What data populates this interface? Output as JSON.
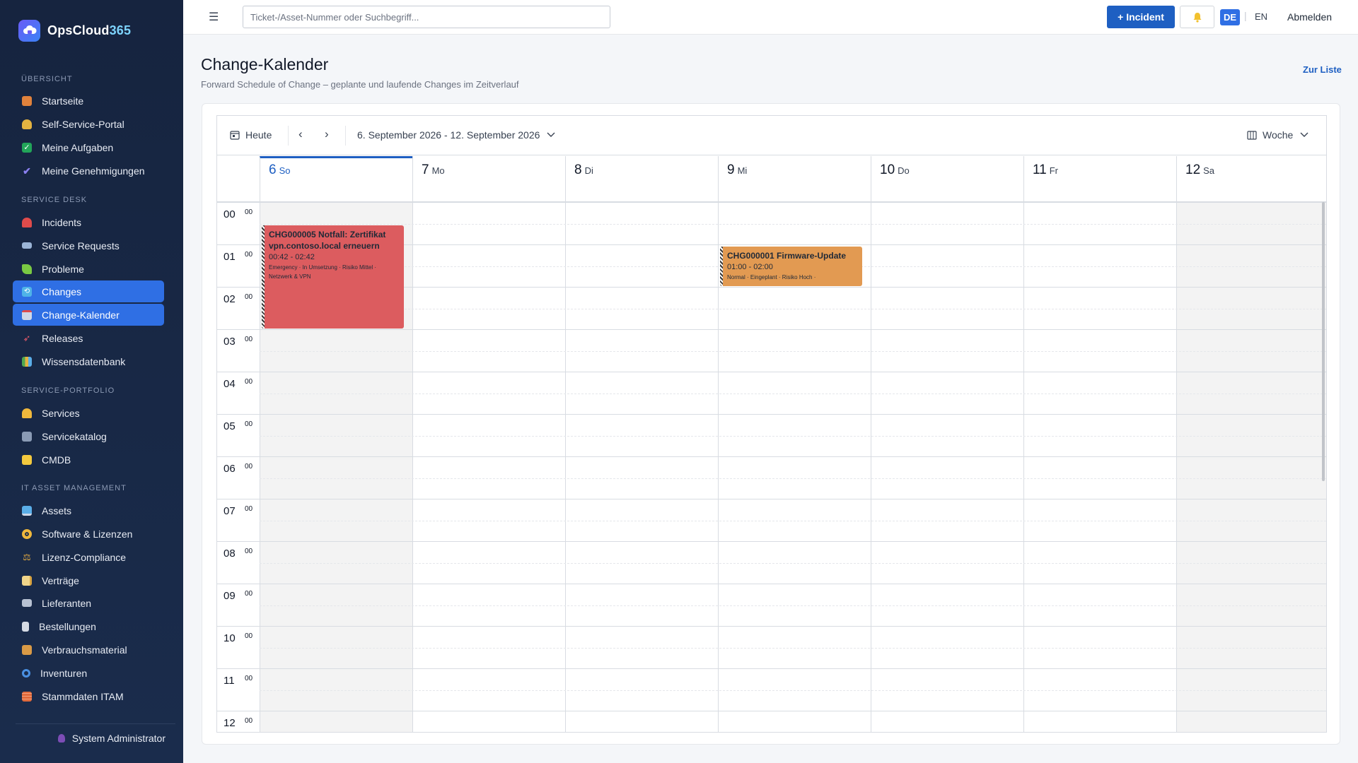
{
  "brand": {
    "name": "OpsCloud",
    "suffix": "365"
  },
  "sidebar": {
    "sections": [
      {
        "label": "Übersicht"
      },
      {
        "label": "Service Desk"
      },
      {
        "label": "Service-Portfolio"
      },
      {
        "label": "IT Asset Management"
      }
    ],
    "items": [
      {
        "label": "Startseite",
        "icon": "house-icon",
        "color": "#e0823c"
      },
      {
        "label": "Self-Service-Portal",
        "icon": "person-icon",
        "color": "#e3b341"
      },
      {
        "label": "Meine Aufgaben",
        "icon": "checkbox-icon",
        "color": "#22a559"
      },
      {
        "label": "Meine Genehmigungen",
        "icon": "check-icon",
        "color": "#8b80f0"
      },
      {
        "label": "Incidents",
        "icon": "siren-icon",
        "color": "#e04b4b"
      },
      {
        "label": "Service Requests",
        "icon": "tray-icon",
        "color": "#9bb4d6"
      },
      {
        "label": "Probleme",
        "icon": "puzzle-icon",
        "color": "#7ac943"
      },
      {
        "label": "Changes",
        "icon": "refresh-icon",
        "color": "#4fb3e8"
      },
      {
        "label": "Change-Kalender",
        "icon": "calendar-icon",
        "color": "#cfd8e8"
      },
      {
        "label": "Releases",
        "icon": "rocket-icon",
        "color": "#e85a6b"
      },
      {
        "label": "Wissensdatenbank",
        "icon": "books-icon",
        "color": "#4fa84f"
      },
      {
        "label": "Services",
        "icon": "bell-icon",
        "color": "#f0b83c"
      },
      {
        "label": "Servicekatalog",
        "icon": "catalog-icon",
        "color": "#8a9bb5"
      },
      {
        "label": "CMDB",
        "icon": "folder-icon",
        "color": "#f3c93e"
      },
      {
        "label": "Assets",
        "icon": "monitor-icon",
        "color": "#5aaee8"
      },
      {
        "label": "Software & Lizenzen",
        "icon": "disc-icon",
        "color": "#f0b83c"
      },
      {
        "label": "Lizenz-Compliance",
        "icon": "scale-icon",
        "color": "#d9a441"
      },
      {
        "label": "Verträge",
        "icon": "document-icon",
        "color": "#f0d58a"
      },
      {
        "label": "Lieferanten",
        "icon": "truck-icon",
        "color": "#b8c2d3"
      },
      {
        "label": "Bestellungen",
        "icon": "receipt-icon",
        "color": "#d6dbe4"
      },
      {
        "label": "Verbrauchsmaterial",
        "icon": "box-icon",
        "color": "#d99a46"
      },
      {
        "label": "Inventuren",
        "icon": "magnifier-icon",
        "color": "#4a90e2"
      },
      {
        "label": "Stammdaten ITAM",
        "icon": "bricks-icon",
        "color": "#e06a3c"
      }
    ],
    "user": "System Administrator"
  },
  "topbar": {
    "search_placeholder": "Ticket-/Asset-Nummer oder Suchbegriff...",
    "incident_button": "+ Incident",
    "lang_de": "DE",
    "lang_en": "EN",
    "logout": "Abmelden"
  },
  "page": {
    "title": "Change-Kalender",
    "subtitle": "Forward Schedule of Change – geplante und laufende Changes im Zeitverlauf",
    "back_link": "Zur Liste"
  },
  "calendar": {
    "today_label": "Heute",
    "range": "6. September 2026 - 12. September 2026",
    "view": "Woche",
    "days": [
      {
        "num": "6",
        "name": "So"
      },
      {
        "num": "7",
        "name": "Mo"
      },
      {
        "num": "8",
        "name": "Di"
      },
      {
        "num": "9",
        "name": "Mi"
      },
      {
        "num": "10",
        "name": "Do"
      },
      {
        "num": "11",
        "name": "Fr"
      },
      {
        "num": "12",
        "name": "Sa"
      }
    ],
    "hours": [
      "00",
      "01",
      "02",
      "03",
      "04",
      "05",
      "06",
      "07",
      "08",
      "09",
      "10",
      "11",
      "12"
    ],
    "minute_label": "00",
    "events": [
      {
        "title": "CHG000005 Notfall: Zertifikat vpn.contoso.local erneuern",
        "time": "00:42 - 02:42",
        "meta": "Emergency · In Umsetzung · Risiko Mittel · Netzwerk & VPN",
        "color": "#dc5c5f"
      },
      {
        "title": "CHG000001 Firmware-Update",
        "time": "01:00 - 02:00",
        "meta": "Normal · Eingeplant · Risiko Hoch ·",
        "color": "#e29a52"
      }
    ]
  },
  "colors": {
    "accent": "#1e5fc2",
    "sidebar_active": "#2f6fe4",
    "sidebar_bg": "#16243f"
  }
}
